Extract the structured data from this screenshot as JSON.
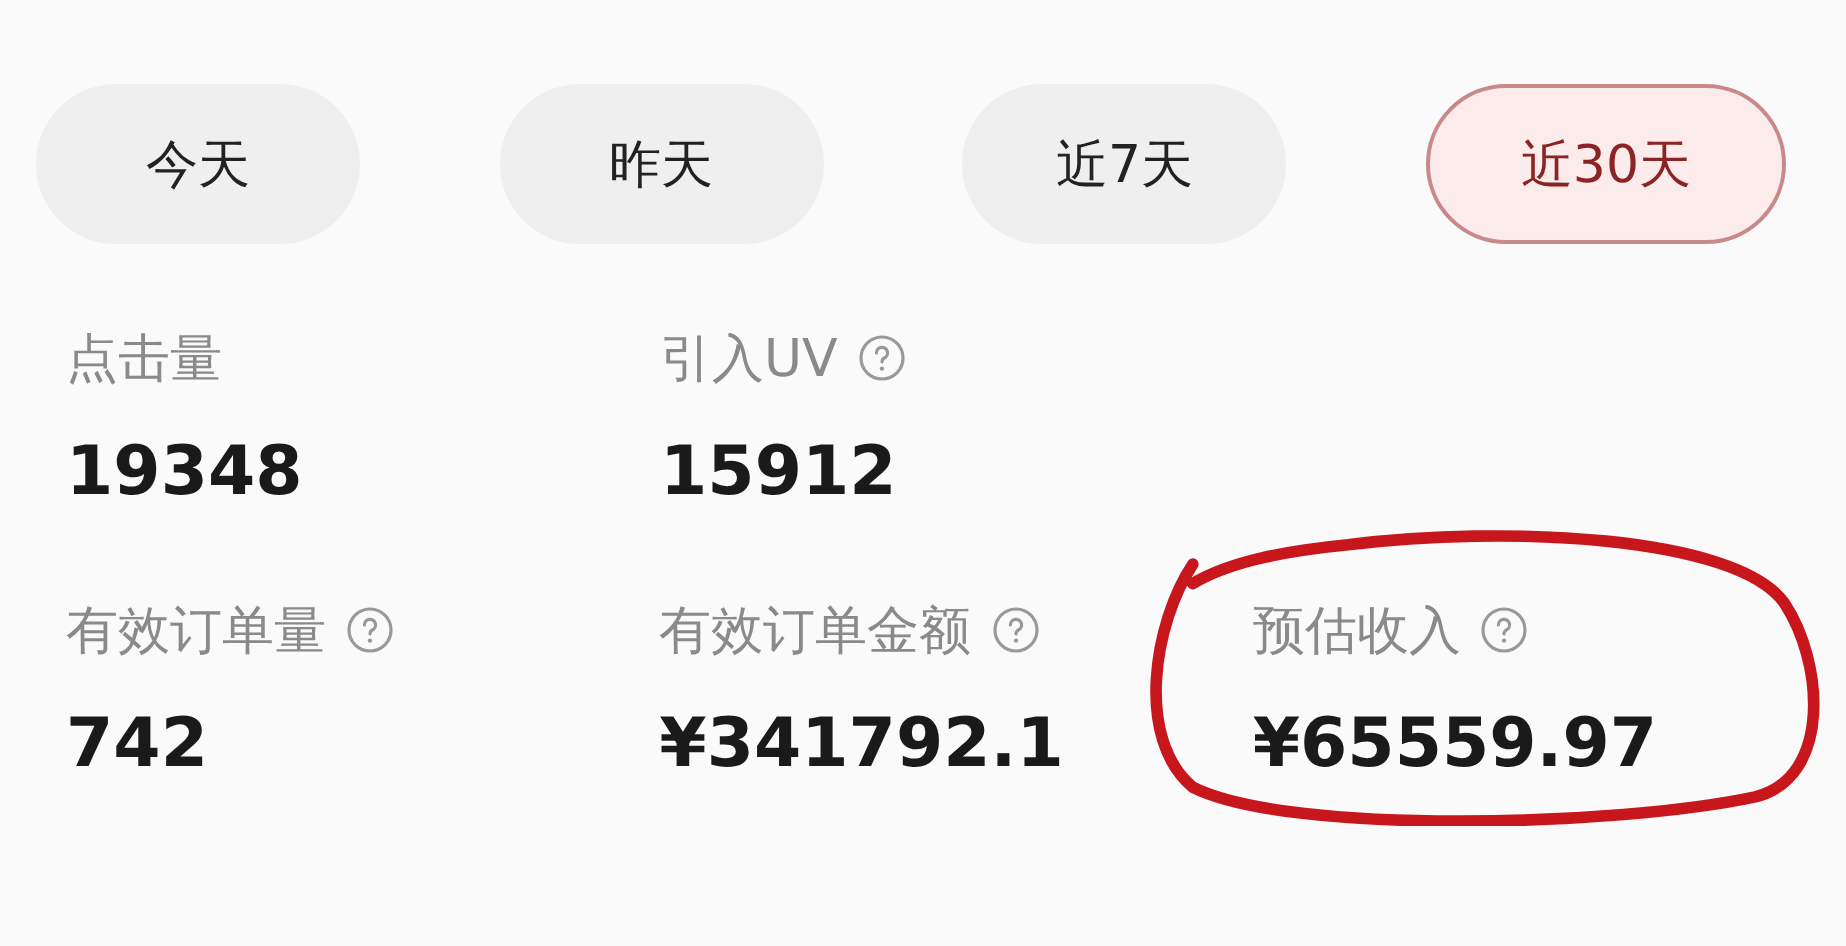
{
  "tabs": [
    {
      "label": "今天",
      "selected": false
    },
    {
      "label": "昨天",
      "selected": false
    },
    {
      "label": "近7天",
      "selected": false
    },
    {
      "label": "近30天",
      "selected": true
    }
  ],
  "metric_rows": [
    [
      {
        "label": "点击量",
        "value": "19348",
        "help": false,
        "circled": false
      },
      {
        "label": "引入UV",
        "value": "15912",
        "help": true,
        "circled": false
      }
    ],
    [
      {
        "label": "有效订单量",
        "value": "742",
        "help": true,
        "circled": false
      },
      {
        "label": "有效订单金额",
        "value": "¥341792.1",
        "help": true,
        "circled": false
      },
      {
        "label": "预估收入",
        "value": "¥65559.97",
        "help": true,
        "circled": true
      }
    ]
  ]
}
